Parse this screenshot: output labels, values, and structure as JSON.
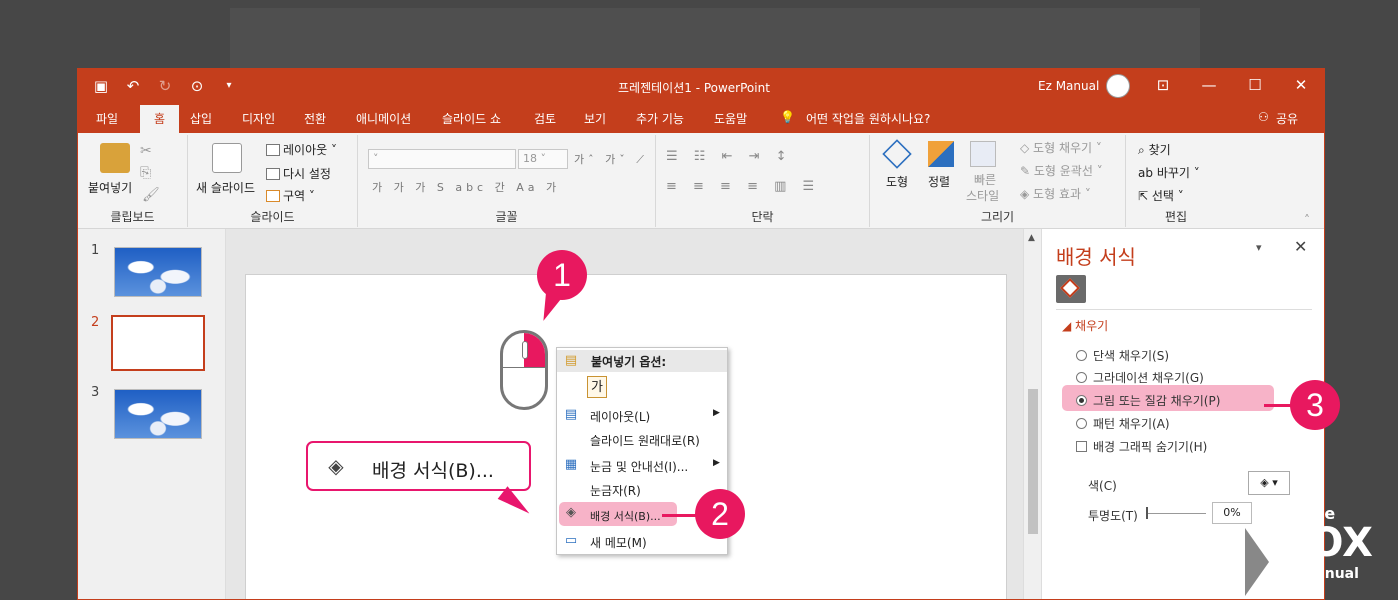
{
  "window": {
    "title": "프레젠테이션1  -  PowerPoint",
    "user": "Ez Manual"
  },
  "tabs": [
    "파일",
    "홈",
    "삽입",
    "디자인",
    "전환",
    "애니메이션",
    "슬라이드 쇼",
    "검토",
    "보기",
    "추가 기능",
    "도움말"
  ],
  "tell_me": "어떤 작업을 원하시나요?",
  "share": "공유",
  "ribbon": {
    "clipboard": {
      "label": "클립보드",
      "paste": "붙여넣기"
    },
    "slides": {
      "label": "슬라이드",
      "new_slide": "새 슬라이드",
      "layout": "레이아웃",
      "reset": "다시 설정",
      "section": "구역"
    },
    "font": {
      "label": "글꼴",
      "size": "18"
    },
    "paragraph": {
      "label": "단락"
    },
    "drawing": {
      "label": "그리기",
      "shapes": "도형",
      "arrange": "정렬",
      "quick_styles_1": "빠른",
      "quick_styles_2": "스타일",
      "shape_fill": "도형 채우기",
      "shape_outline": "도형 윤곽선",
      "shape_effects": "도형 효과"
    },
    "editing": {
      "label": "편집",
      "find": "찾기",
      "replace": "바꾸기",
      "select": "선택"
    }
  },
  "thumbnails": [
    "1",
    "2",
    "3"
  ],
  "context_menu": {
    "header": "붙여넣기 옵션:",
    "paste_glyph": "가",
    "items": [
      "레이아웃(L)",
      "슬라이드 원래대로(R)",
      "눈금 및 안내선(I)...",
      "눈금자(R)",
      "배경 서식(B)...",
      "새 메모(M)"
    ]
  },
  "callout": "배경 서식(B)...",
  "badges": [
    "1",
    "2",
    "3"
  ],
  "format_pane": {
    "title": "배경 서식",
    "section": "채우기",
    "options": [
      "단색 채우기(S)",
      "그라데이션 채우기(G)",
      "그림 또는 질감 채우기(P)",
      "패턴 채우기(A)"
    ],
    "selected": "그림 또는 질감 채우기(P)",
    "hide_graphics": "배경 그래픽 숨기기(H)",
    "color_label": "색(C)",
    "transparency_label": "투명도(T)",
    "transparency_value": "0%"
  },
  "logo": {
    "line1": "inside",
    "line2": "BOX",
    "line3": "EZmanual"
  },
  "colors": {
    "accent": "#c43e1c",
    "highlight": "#e8185f"
  }
}
